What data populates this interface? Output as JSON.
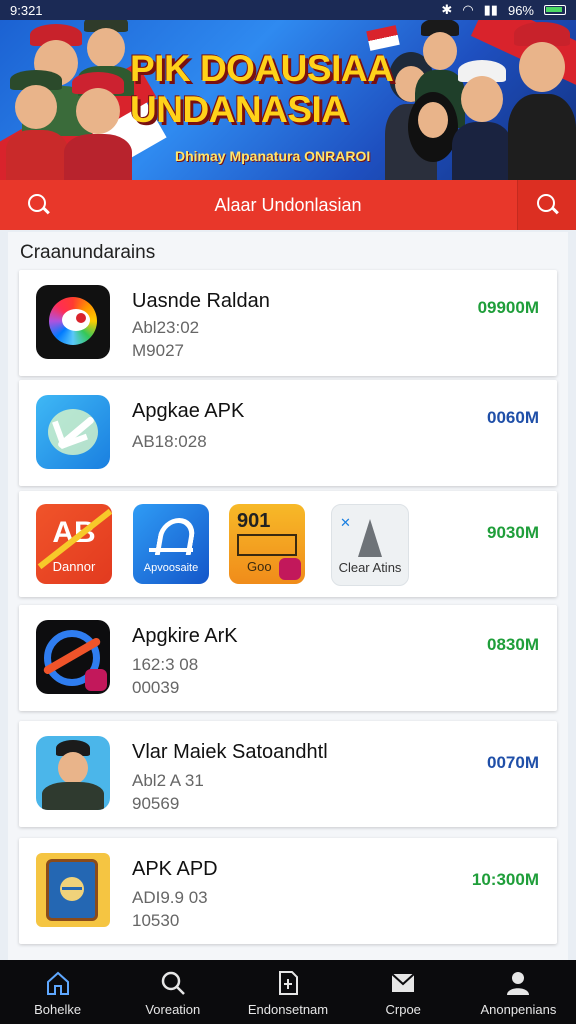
{
  "status": {
    "time": "9:321",
    "battery": "96%"
  },
  "banner": {
    "title_line1": "PIK DOAUSIAA",
    "title_line2": "UNDANASIA",
    "subtitle": "Dhimay Mpanatura ONRAROI"
  },
  "search": {
    "title": "Alaar Undonlasian"
  },
  "section": {
    "title": "Craanundarains"
  },
  "apps": [
    {
      "name": "Uasnde Raldan",
      "line1": "Abl23:02",
      "line2": "M9027",
      "size": "09900M",
      "size_color": "#1f9e3a"
    },
    {
      "name": "Apgkae APK",
      "line1": "AB18:028",
      "line2": "",
      "size": "0060M",
      "size_color": "#1f4fa8"
    },
    {
      "name": "Apgkire ArK",
      "line1": "162:3 08",
      "line2": "00039",
      "size": "0830M",
      "size_color": "#1f9e3a"
    },
    {
      "name": "Vlar Maiek Satoandhtl",
      "line1": "Abl2 A 31",
      "line2": "90569",
      "size": "0070M",
      "size_color": "#1f4fa8"
    },
    {
      "name": "APK APD",
      "line1": "ADI9.9 03",
      "line2": "10530",
      "size": "10:300M",
      "size_color": "#1f9e3a"
    }
  ],
  "multi_row": {
    "size": "9030M",
    "icons": [
      {
        "badge": "AB",
        "label": "Dannor"
      },
      {
        "badge": "",
        "label": "Apvoosaite"
      },
      {
        "badge": "901",
        "label": "Goo"
      },
      {
        "badge": "",
        "label": "Clear Atins"
      }
    ]
  },
  "nav": [
    {
      "label": "Bohelke",
      "icon": "home-icon"
    },
    {
      "label": "Voreation",
      "icon": "search-icon"
    },
    {
      "label": "Endonsetnam",
      "icon": "doc-icon"
    },
    {
      "label": "Crpoe",
      "icon": "mail-icon"
    },
    {
      "label": "Anonpenians",
      "icon": "user-icon"
    }
  ]
}
